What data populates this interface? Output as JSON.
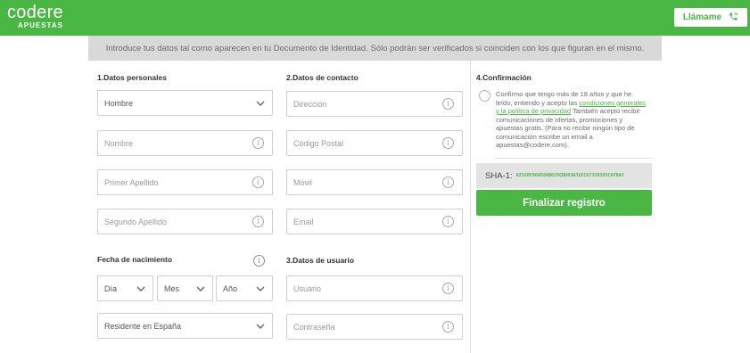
{
  "header": {
    "logo_main": "codere",
    "logo_sub": "APUESTAS",
    "call_label": "Llámame",
    "brand_color": "#4ab745"
  },
  "banner": {
    "text": "Introduce tus datos tal como aparecen en tu Documento de Identidad. Sólo podrán ser verificados si coinciden con los que figuran en el mismo."
  },
  "personal": {
    "title": "1.Datos personales",
    "gender_select": "Hombre",
    "name_placeholder": "Nombre",
    "surname1_placeholder": "Primer Apellido",
    "surname2_placeholder": "Segundo Apellido"
  },
  "contact": {
    "title": "2.Datos de contacto",
    "address_placeholder": "Dirección",
    "postal_placeholder": "Código Postal",
    "mobile_placeholder": "Móvil",
    "email_placeholder": "Email"
  },
  "birth": {
    "title": "Fecha de nacimiento",
    "day": "Día",
    "month": "Mes",
    "year": "Año",
    "residence": "Residente en España"
  },
  "user": {
    "title": "3.Datos de usuario",
    "username_placeholder": "Usuario",
    "password_placeholder": "Contraseña"
  },
  "confirmation": {
    "title": "4.Confirmación",
    "text_before_link": "Confirmo que tengo más de 18 años y que he leído, entiendo y acepto las ",
    "link_text": "condiciones generales y la política de privacidad",
    "text_after_link": " También acepto recibir comunicaciones de ofertas, promociones y apuestas gratis. (Para no recibir ningún tipo de comunicación escribe un email a apuestas@codere.com).",
    "sha_label": "SHA-1:",
    "sha_value": "82520F868E86B029CBD63A31EC67338395C6FBA3",
    "finalize_label": "Finalizar registro"
  },
  "icons": {
    "info": "info-icon",
    "chevron": "chevron-down-icon",
    "phone": "phone-icon"
  }
}
